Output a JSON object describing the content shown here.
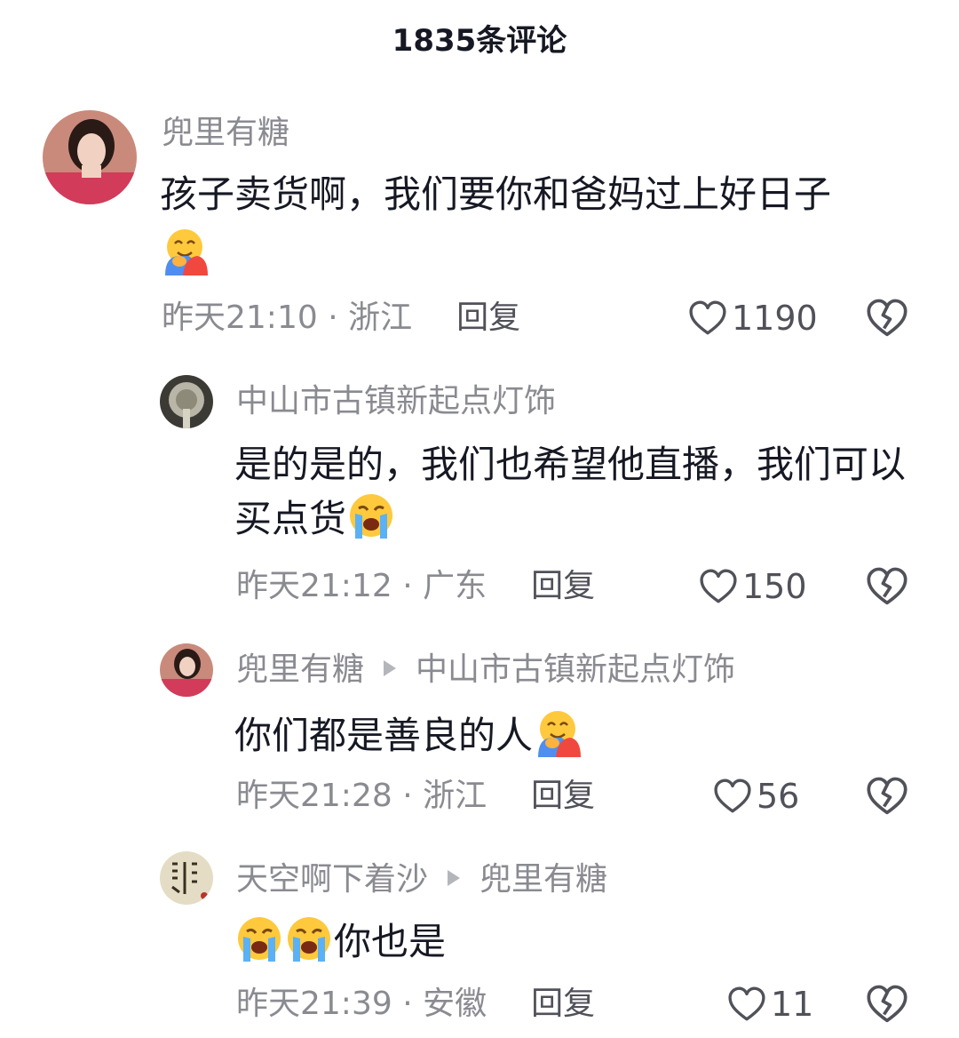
{
  "header": {
    "title": "1835条评论"
  },
  "comments": [
    {
      "author": "兜里有糖",
      "reply_to": "",
      "text": "孩子卖货啊，我们要你和爸妈过上好日子",
      "emoji": "hug-emoji",
      "time": "昨天21:10",
      "location": "浙江",
      "reply_label": "回复",
      "likes": "1190"
    },
    {
      "author": "中山市古镇新起点灯饰",
      "reply_to": "",
      "text": "是的是的，我们也希望他直播，我们可以买点货",
      "emoji": "loudly-crying-emoji",
      "time": "昨天21:12",
      "location": "广东",
      "reply_label": "回复",
      "likes": "150"
    },
    {
      "author": "兜里有糖",
      "reply_to": "中山市古镇新起点灯饰",
      "text": "你们都是善良的人",
      "emoji": "hug-emoji",
      "time": "昨天21:28",
      "location": "浙江",
      "reply_label": "回复",
      "likes": "56"
    },
    {
      "author": "天空啊下着沙",
      "reply_to": "兜里有糖",
      "text": "你也是",
      "emoji": "loudly-crying-emoji",
      "time": "昨天21:39",
      "location": "安徽",
      "reply_label": "回复",
      "likes": "11"
    }
  ],
  "separator": " · ",
  "colors": {
    "secondary_text": "#8a8b91",
    "primary_text": "#161823",
    "icon": "#505159"
  }
}
